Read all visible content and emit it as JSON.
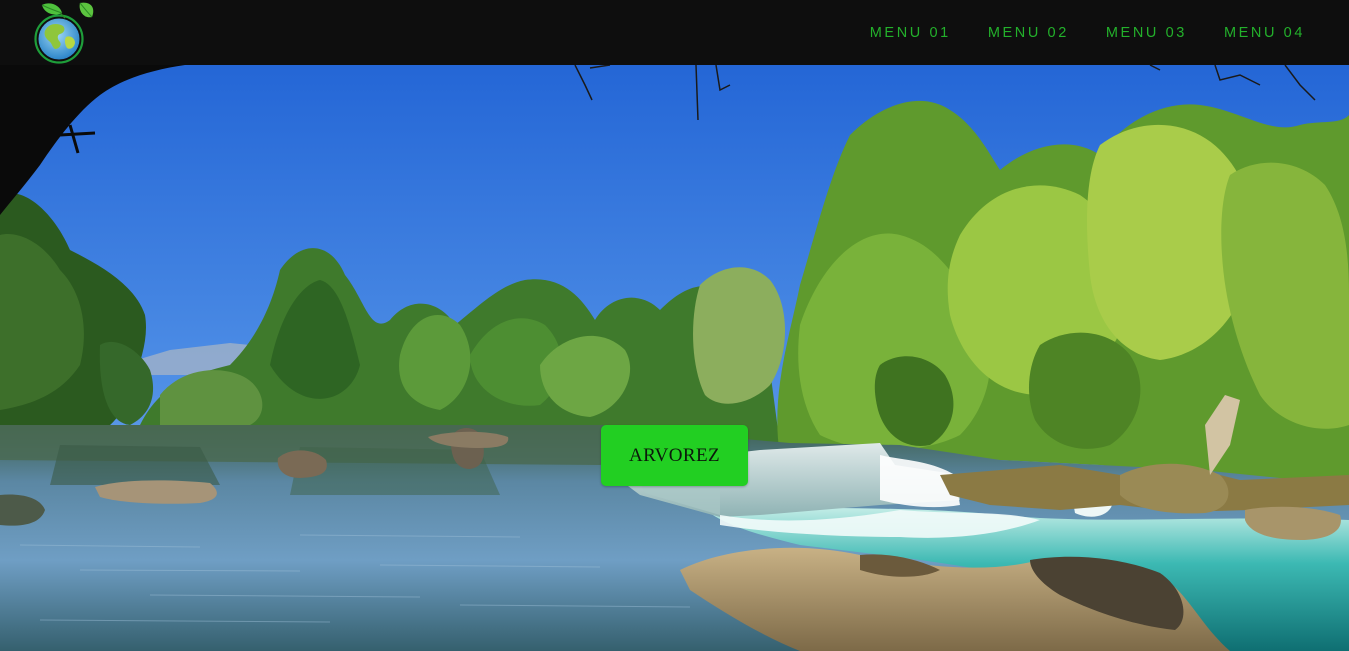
{
  "header": {
    "logo_icon": "globe-with-leaves-icon",
    "menu": [
      {
        "label": "MENU 01"
      },
      {
        "label": "MENU 02"
      },
      {
        "label": "MENU 03"
      },
      {
        "label": "MENU 04"
      }
    ]
  },
  "hero": {
    "image": "river-waterfall-landscape",
    "button_label": "ARVOREZ"
  },
  "colors": {
    "nav_background": "#0e0e0e",
    "menu_text": "#23b02b",
    "button_background": "#22cf22",
    "button_text": "#0b1a0b"
  }
}
